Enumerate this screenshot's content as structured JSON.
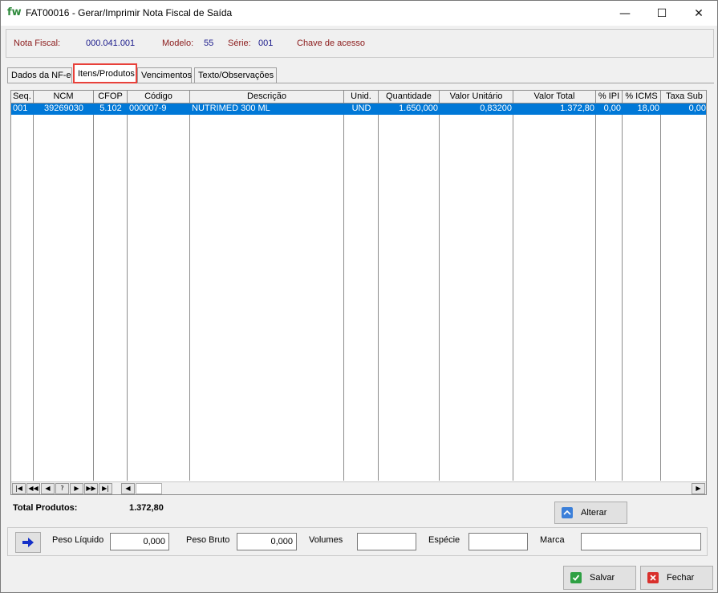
{
  "window": {
    "logo": "fw",
    "title": "FAT00016 - Gerar/Imprimir Nota Fiscal de Saída",
    "minimize_glyph": "—",
    "maximize_glyph": "☐",
    "close_glyph": "✕"
  },
  "header": {
    "nota_fiscal_label": "Nota Fiscal:",
    "nota_fiscal_value": "000.041.001",
    "modelo_label": "Modelo:",
    "modelo_value": "55",
    "serie_label": "Série:",
    "serie_value": "001",
    "chave_label": "Chave de acesso"
  },
  "tabs": [
    {
      "label": "Dados da NF-e",
      "active": false
    },
    {
      "label": "Itens/Produtos",
      "active": true
    },
    {
      "label": "Vencimentos",
      "active": false
    },
    {
      "label": "Texto/Observações",
      "active": false
    }
  ],
  "grid": {
    "columns": [
      "Seq.",
      "NCM",
      "CFOP",
      "Código",
      "Descrição",
      "Unid.",
      "Quantidade",
      "Valor Unitário",
      "Valor Total",
      "% IPI",
      "% ICMS",
      "Taxa Sub"
    ],
    "rows": [
      {
        "seq": "001",
        "ncm": "39269030",
        "cfop": "5.102",
        "codigo": "000007-9",
        "descricao": "NUTRIMED 300 ML",
        "unid": "UND",
        "quantidade": "1.650,000",
        "valor_unitario": "0,83200",
        "valor_total": "1.372,80",
        "ipi": "0,00",
        "icms": "18,00",
        "taxa_sub": "0,00"
      }
    ],
    "nav_buttons": [
      "|◀",
      "◀◀",
      "◀",
      "?",
      "▶",
      "▶▶",
      "▶|"
    ],
    "scroll_left": "◀",
    "scroll_right": "▶"
  },
  "totals": {
    "label": "Total Produtos:",
    "value": "1.372,80"
  },
  "buttons": {
    "alterar": "Alterar",
    "salvar": "Salvar",
    "fechar": "Fechar"
  },
  "bottom": {
    "peso_liquido_label": "Peso Líquido",
    "peso_liquido_value": "0,000",
    "peso_bruto_label": "Peso Bruto",
    "peso_bruto_value": "0,000",
    "volumes_label": "Volumes",
    "volumes_value": "",
    "especie_label": "Espécie",
    "especie_value": "",
    "marca_label": "Marca",
    "marca_value": ""
  },
  "colors": {
    "selection": "#0078d7",
    "label_red": "#8b1a1a",
    "value_blue": "#1a1a8b",
    "tab_highlight": "#e8413a",
    "logo_green": "#2f8a3c"
  },
  "icons": {
    "alterar": "edit-icon",
    "salvar": "check-icon",
    "fechar": "close-icon",
    "navigate": "arrow-right-icon"
  }
}
